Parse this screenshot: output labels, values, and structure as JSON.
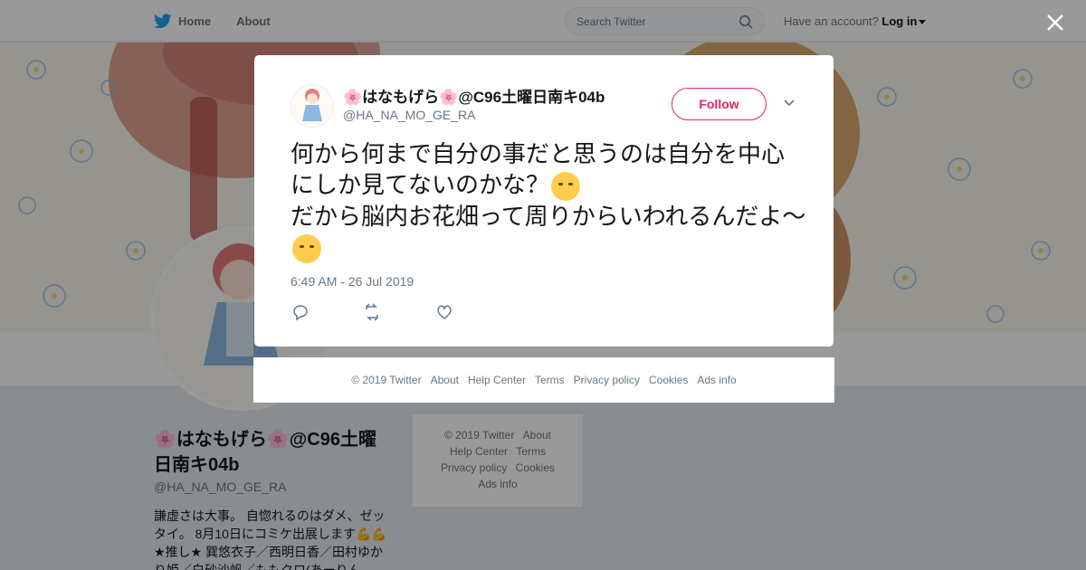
{
  "nav": {
    "home_label": "Home",
    "about_label": "About",
    "search_placeholder": "Search Twitter",
    "account_prompt": "Have an account?",
    "login_label": "Log in"
  },
  "profile": {
    "name": "🌸はなもげら🌸@C96土曜日南キ04b",
    "handle": "@HA_NA_MO_GE_RA",
    "bio": "謙虚さは大事。 自惚れるのはダメ、ゼッタイ。 8月10日にコミケ出展します💪💪　★推し★ 巽悠衣子／西明日香／田村ゆかり姫／白砂沙帆／ももクロ(あーりん"
  },
  "side_footer": {
    "links": [
      "© 2019 Twitter",
      "About",
      "Help Center",
      "Terms",
      "Privacy policy",
      "Cookies",
      "Ads info"
    ]
  },
  "tweet": {
    "author_name": "🌸はなもげら🌸@C96土曜日南キ04b",
    "author_handle": "@HA_NA_MO_GE_RA",
    "follow_label": "Follow",
    "line1": "何から何まで自分の事だと思うのは自分を中心にしか見てないのかな？",
    "line2": "だから脳内お花畑って周りからいわれるんだよ～",
    "timestamp": "6:49 AM - 26 Jul 2019"
  },
  "modal_footer": {
    "links": [
      "© 2019 Twitter",
      "About",
      "Help Center",
      "Terms",
      "Privacy policy",
      "Cookies",
      "Ads info"
    ]
  },
  "colors": {
    "accent": "#1da1f2",
    "follow": "#e0245e",
    "muted": "#657786"
  },
  "icons": [
    "twitter-bird-icon",
    "search-icon",
    "close-icon",
    "chevron-down-icon",
    "reply-icon",
    "retweet-icon",
    "like-icon"
  ]
}
